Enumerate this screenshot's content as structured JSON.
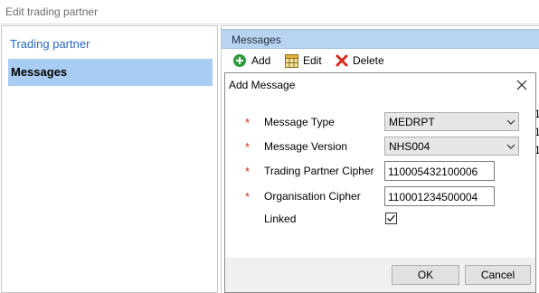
{
  "window": {
    "title": "Edit trading partner"
  },
  "nav": {
    "items": [
      {
        "label": "Trading partner"
      },
      {
        "label": "Messages"
      }
    ]
  },
  "messages_panel": {
    "header": "Messages",
    "toolbar": {
      "add_label": "Add",
      "edit_label": "Edit",
      "delete_label": "Delete"
    },
    "row_fragments": [
      "1",
      "1",
      "1"
    ]
  },
  "dialog": {
    "title": "Add Message",
    "required_mark": "*",
    "fields": {
      "message_type": {
        "label": "Message Type",
        "value": "MEDRPT"
      },
      "message_version": {
        "label": "Message Version",
        "value": "NHS004"
      },
      "trading_partner_cipher": {
        "label": "Trading Partner Cipher",
        "value": "110005432100006"
      },
      "organisation_cipher": {
        "label": "Organisation Cipher",
        "value": "110001234500004"
      },
      "linked": {
        "label": "Linked",
        "checked": true
      }
    },
    "ok_label": "OK",
    "cancel_label": "Cancel"
  },
  "colors": {
    "nav_selected": "#a9cdf2",
    "nav_link": "#2769c2",
    "header_band": "#b8d4f0",
    "required": "#d9261c"
  },
  "icons": {
    "add": "plus-circle-icon",
    "edit": "grid-edit-icon",
    "delete": "red-x-icon",
    "close": "close-icon",
    "dropdown": "chevron-down-icon",
    "check": "checkmark-icon"
  }
}
